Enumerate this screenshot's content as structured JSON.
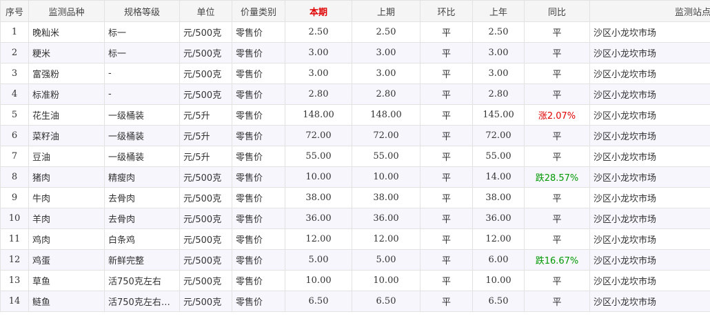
{
  "headers": [
    "序号",
    "监测品种",
    "规格等级",
    "单位",
    "价量类别",
    "本期",
    "上期",
    "环比",
    "上年",
    "同比",
    "监测站点"
  ],
  "colors": {
    "current_header": "#e00000",
    "rise": "#e00000",
    "fall": "#009900",
    "alt_row": "#f7f6fd",
    "header_bg": "#f5f5f5"
  },
  "rows": [
    {
      "no": "1",
      "item": "晚籼米",
      "spec": "标一",
      "unit": "元/500克",
      "type": "零售价",
      "current": "2.50",
      "previous": "2.50",
      "mom": "平",
      "last_year": "2.50",
      "yoy": "平",
      "yoy_trend": "flat",
      "site": "沙区小龙坎市场"
    },
    {
      "no": "2",
      "item": "粳米",
      "spec": "标一",
      "unit": "元/500克",
      "type": "零售价",
      "current": "3.00",
      "previous": "3.00",
      "mom": "平",
      "last_year": "3.00",
      "yoy": "平",
      "yoy_trend": "flat",
      "site": "沙区小龙坎市场"
    },
    {
      "no": "3",
      "item": "富强粉",
      "spec": "-",
      "unit": "元/500克",
      "type": "零售价",
      "current": "3.00",
      "previous": "3.00",
      "mom": "平",
      "last_year": "3.00",
      "yoy": "平",
      "yoy_trend": "flat",
      "site": "沙区小龙坎市场"
    },
    {
      "no": "4",
      "item": "标准粉",
      "spec": "-",
      "unit": "元/500克",
      "type": "零售价",
      "current": "2.80",
      "previous": "2.80",
      "mom": "平",
      "last_year": "2.80",
      "yoy": "平",
      "yoy_trend": "flat",
      "site": "沙区小龙坎市场"
    },
    {
      "no": "5",
      "item": "花生油",
      "spec": "一级桶装",
      "unit": "元/5升",
      "type": "零售价",
      "current": "148.00",
      "previous": "148.00",
      "mom": "平",
      "last_year": "145.00",
      "yoy": "涨2.07%",
      "yoy_trend": "up",
      "site": "沙区小龙坎市场"
    },
    {
      "no": "6",
      "item": "菜籽油",
      "spec": "一级桶装",
      "unit": "元/5升",
      "type": "零售价",
      "current": "72.00",
      "previous": "72.00",
      "mom": "平",
      "last_year": "72.00",
      "yoy": "平",
      "yoy_trend": "flat",
      "site": "沙区小龙坎市场"
    },
    {
      "no": "7",
      "item": "豆油",
      "spec": "一级桶装",
      "unit": "元/5升",
      "type": "零售价",
      "current": "55.00",
      "previous": "55.00",
      "mom": "平",
      "last_year": "55.00",
      "yoy": "平",
      "yoy_trend": "flat",
      "site": "沙区小龙坎市场"
    },
    {
      "no": "8",
      "item": "猪肉",
      "spec": "精瘦肉",
      "unit": "元/500克",
      "type": "零售价",
      "current": "10.00",
      "previous": "10.00",
      "mom": "平",
      "last_year": "14.00",
      "yoy": "跌28.57%",
      "yoy_trend": "down",
      "site": "沙区小龙坎市场"
    },
    {
      "no": "9",
      "item": "牛肉",
      "spec": "去骨肉",
      "unit": "元/500克",
      "type": "零售价",
      "current": "38.00",
      "previous": "38.00",
      "mom": "平",
      "last_year": "38.00",
      "yoy": "平",
      "yoy_trend": "flat",
      "site": "沙区小龙坎市场"
    },
    {
      "no": "10",
      "item": "羊肉",
      "spec": "去骨肉",
      "unit": "元/500克",
      "type": "零售价",
      "current": "36.00",
      "previous": "36.00",
      "mom": "平",
      "last_year": "36.00",
      "yoy": "平",
      "yoy_trend": "flat",
      "site": "沙区小龙坎市场"
    },
    {
      "no": "11",
      "item": "鸡肉",
      "spec": "白条鸡",
      "unit": "元/500克",
      "type": "零售价",
      "current": "12.00",
      "previous": "12.00",
      "mom": "平",
      "last_year": "12.00",
      "yoy": "平",
      "yoy_trend": "flat",
      "site": "沙区小龙坎市场"
    },
    {
      "no": "12",
      "item": "鸡蛋",
      "spec": "新鲜完整",
      "unit": "元/500克",
      "type": "零售价",
      "current": "5.00",
      "previous": "5.00",
      "mom": "平",
      "last_year": "6.00",
      "yoy": "跌16.67%",
      "yoy_trend": "down",
      "site": "沙区小龙坎市场"
    },
    {
      "no": "13",
      "item": "草鱼",
      "spec": "活750克左右",
      "unit": "元/500克",
      "type": "零售价",
      "current": "10.00",
      "previous": "10.00",
      "mom": "平",
      "last_year": "10.00",
      "yoy": "平",
      "yoy_trend": "flat",
      "site": "沙区小龙坎市场"
    },
    {
      "no": "14",
      "item": "鲢鱼",
      "spec": "活750克左右…",
      "unit": "元/500克",
      "type": "零售价",
      "current": "6.50",
      "previous": "6.50",
      "mom": "平",
      "last_year": "6.50",
      "yoy": "平",
      "yoy_trend": "flat",
      "site": "沙区小龙坎市场"
    }
  ]
}
